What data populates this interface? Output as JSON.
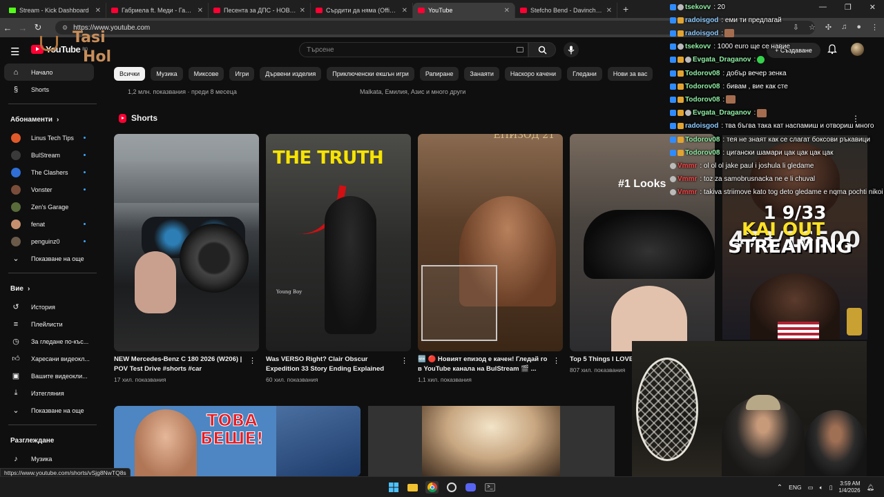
{
  "browser": {
    "tabs": [
      {
        "label": "Stream - Kick Dashboard",
        "icon": "kick-favicon"
      },
      {
        "label": "Габриела ft. Меди - Габриела",
        "icon": "youtube-favicon"
      },
      {
        "label": "Песента за ДПС - НОВО НАЧАЛ",
        "icon": "youtube-favicon"
      },
      {
        "label": "Сърдити да няма (Offical AI Ar",
        "icon": "youtube-favicon"
      },
      {
        "label": "YouTube",
        "icon": "youtube-favicon",
        "active": true
      },
      {
        "label": "Stefcho Bend - Davinchi Zakon",
        "icon": "youtube-favicon"
      }
    ],
    "url": "https://www.youtube.com",
    "status_url": "https://www.youtube.com/shorts/vSjg8NwTQ8s"
  },
  "youtube": {
    "logo_text": "YouTube",
    "logo_country": "BG",
    "search_placeholder": "Търсене",
    "create_label": "+ Създаване",
    "chips": [
      "Всички",
      "Музика",
      "Миксове",
      "Игри",
      "Дървени изделия",
      "Приключенски екшън игри",
      "Рапиране",
      "Занаяти",
      "Наскоро качени",
      "Гледани",
      "Нови за вас"
    ],
    "prev_meta_left": "1,2 млн. показвания · преди 8 месеца",
    "prev_meta_right": "Malkata, Емилия, Азис и много други",
    "shorts_title": "Shorts",
    "shorts": [
      {
        "title": "NEW Mercedes-Benz C 180 2026 (W206) | POV Test Drive #shorts #car",
        "views": "17 хил. показвания"
      },
      {
        "title": "Was VERSO Right? Clair Obscur Expedition 33 Story Ending Explained",
        "views": "60 хил. показвания",
        "overlay": "THE TRUTH",
        "caption": "Young Boy"
      },
      {
        "title": "🆕 🔴 Новият епизод е качен! Гледай го в YouTube канала на BulStream 🎬 ...",
        "views": "1,1 хил. показвания",
        "overlay": "ЕПИЗОД 21"
      },
      {
        "title": "Top 5 Things I LOVE #mercedes #cls #am",
        "views": "807 хил. показвания",
        "overlay": "#1 Looks"
      }
    ],
    "bottom_thumbs": [
      {
        "overlay_lines": [
          "ТОВА",
          "БЕШЕ!"
        ]
      },
      {
        "overlay_lines": []
      }
    ]
  },
  "sidebar": {
    "top": [
      {
        "label": "Начало",
        "icon": "home-icon",
        "active": true
      },
      {
        "label": "Shorts",
        "icon": "shorts-icon"
      }
    ],
    "subscriptions_title": "Абонаменти",
    "subscriptions": [
      {
        "label": "Linus Tech Tips",
        "color": "#e0592a",
        "dot": true
      },
      {
        "label": "BulStream",
        "color": "#3a3a3a",
        "dot": true
      },
      {
        "label": "The Clashers",
        "color": "#2f6fd6",
        "dot": true
      },
      {
        "label": "Vonster",
        "color": "#7a4d3a",
        "dot": true
      },
      {
        "label": "Zen's Garage",
        "color": "#5a6b3a",
        "dot": false
      },
      {
        "label": "fenat",
        "color": "#c58f6f",
        "dot": true
      },
      {
        "label": "penguinz0",
        "color": "#6b5a4a",
        "dot": true
      }
    ],
    "subs_more": "Показване на още",
    "you_title": "Вие",
    "you_items": [
      {
        "label": "История",
        "icon": "history-icon"
      },
      {
        "label": "Плейлисти",
        "icon": "playlists-icon"
      },
      {
        "label": "За гледане по-къс...",
        "icon": "watch-later-icon"
      },
      {
        "label": "Харесани видеокл...",
        "icon": "like-icon"
      },
      {
        "label": "Вашите видеокли...",
        "icon": "your-videos-icon"
      },
      {
        "label": "Изтегляния",
        "icon": "download-icon"
      }
    ],
    "you_more": "Показване на още",
    "explore_title": "Разглеждане",
    "explore_items": [
      {
        "label": "Музика",
        "icon": "music-icon"
      },
      {
        "label": "Игри",
        "icon": "games-icon"
      }
    ]
  },
  "stream_chat": [
    {
      "nick": "tsekovv",
      "color": "#8ff0a4",
      "badges": [
        "blue",
        "grey"
      ],
      "msg": ": 20"
    },
    {
      "nick": "radoisgod",
      "color": "#8ecbff",
      "badges": [
        "blue",
        "gold"
      ],
      "msg": ": еми ти предлагай"
    },
    {
      "nick": "radoisgod",
      "color": "#8ecbff",
      "badges": [
        "blue",
        "gold"
      ],
      "msg": ":",
      "emote": true
    },
    {
      "nick": "tsekovv",
      "color": "#8ff0a4",
      "badges": [
        "blue",
        "grey"
      ],
      "msg": ": 1000 euro ще се навие"
    },
    {
      "nick": "Evgata_Draganov",
      "color": "#8ff0a4",
      "badges": [
        "blue",
        "gold",
        "grey"
      ],
      "msg": ":",
      "green": true
    },
    {
      "nick": "Todorov08",
      "color": "#8ff0a4",
      "badges": [
        "blue",
        "gold"
      ],
      "msg": ": добър вечер зенка"
    },
    {
      "nick": "Todorov08",
      "color": "#8ff0a4",
      "badges": [
        "blue",
        "gold"
      ],
      "msg": ": бивам , вие как сте"
    },
    {
      "nick": "Todorov08",
      "color": "#8ff0a4",
      "badges": [
        "blue",
        "gold"
      ],
      "msg": ":",
      "emote": true
    },
    {
      "nick": "Evgata_Draganov",
      "color": "#8ff0a4",
      "badges": [
        "blue",
        "gold",
        "grey"
      ],
      "msg": ":",
      "emote": true
    },
    {
      "nick": "radoisgod",
      "color": "#8ecbff",
      "badges": [
        "blue",
        "gold"
      ],
      "msg": ": тва бъгва така кат наспамиш и отвориш много"
    },
    {
      "nick": "Todorov08",
      "color": "#8ff0a4",
      "badges": [
        "blue",
        "gold"
      ],
      "msg": ": тея не знаят как се слагат боксови ръкавици"
    },
    {
      "nick": "Todorov08",
      "color": "#8ff0a4",
      "badges": [
        "blue",
        "gold"
      ],
      "msg": ": цигански шамари цак цак цак цак"
    },
    {
      "nick": "Vmmr",
      "color": "#ff4a4a",
      "badges": [
        "grey"
      ],
      "msg": ": ol ol ol jake paul i joshula li gledame"
    },
    {
      "nick": "Vmmr",
      "color": "#ff4a4a",
      "badges": [
        "grey"
      ],
      "msg": ": toz za samobrusnacka ne e li chuval"
    },
    {
      "nick": "Vmmr",
      "color": "#ff4a4a",
      "badges": [
        "grey"
      ],
      "msg": ": takiva striimove kato tog deto gledame e nqma pochti nikoi"
    }
  ],
  "stream_overlay": {
    "line1": "1 9/33",
    "line2": "473/16500",
    "line3": "KAI OUT",
    "line4": "STREAMING"
  },
  "channel_watermark": {
    "line1": "Tasi",
    "line2": "Hol"
  },
  "taskbar": {
    "lang": "ENG",
    "time": "3:59 AM",
    "date": "1/4/2026"
  }
}
